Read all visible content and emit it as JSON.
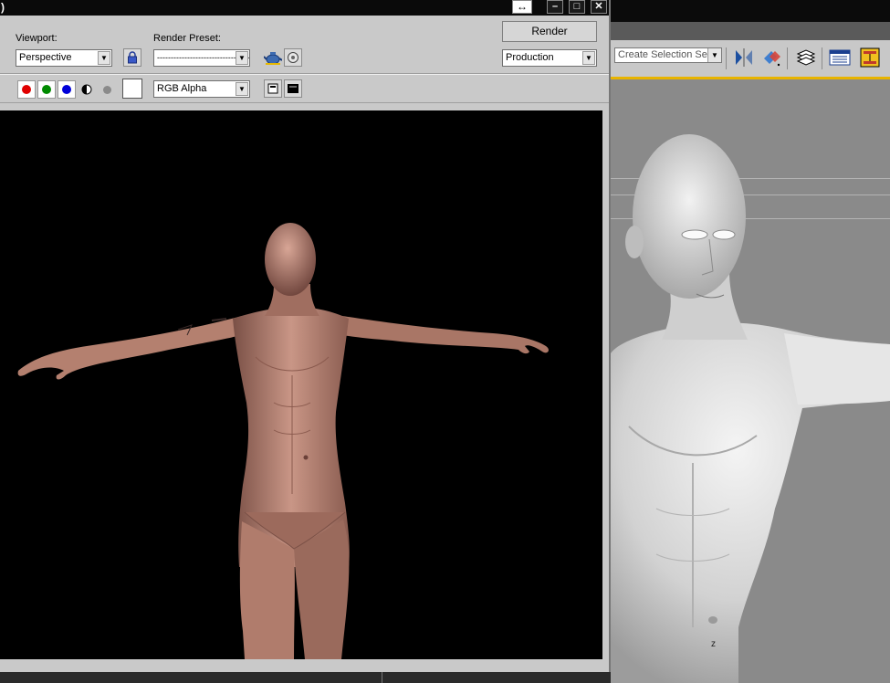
{
  "render_frame": {
    "title": ")",
    "viewport_label": "Viewport:",
    "viewport_value": "Perspective",
    "render_preset_label": "Render Preset:",
    "render_preset_value": "------------------------------------",
    "render_button": "Render",
    "production_value": "Production",
    "channel_display_value": "RGB Alpha",
    "icons": [
      "lock-icon",
      "teapot-icon",
      "settings-icon",
      "red-channel-icon",
      "green-channel-icon",
      "blue-channel-icon",
      "alpha-channel-icon",
      "monochrome-icon",
      "clone-frame-icon",
      "clear-frame-icon"
    ]
  },
  "main_app": {
    "selection_set_placeholder": "Create Selection Set",
    "viewport_axis_label": "z",
    "toolbar_icons": [
      "mirror-icon",
      "align-icon",
      "layer-manager-icon",
      "track-view-icon",
      "schematic-view-icon"
    ]
  },
  "colors": {
    "title_bar": "#0a0a0a",
    "panel_bg": "#c9c9c9",
    "viewport_bg": "#8a8a8a",
    "accent_yellow": "#e8b400",
    "channel_red": "#e00000",
    "channel_green": "#008a00",
    "channel_blue": "#0000d8"
  }
}
